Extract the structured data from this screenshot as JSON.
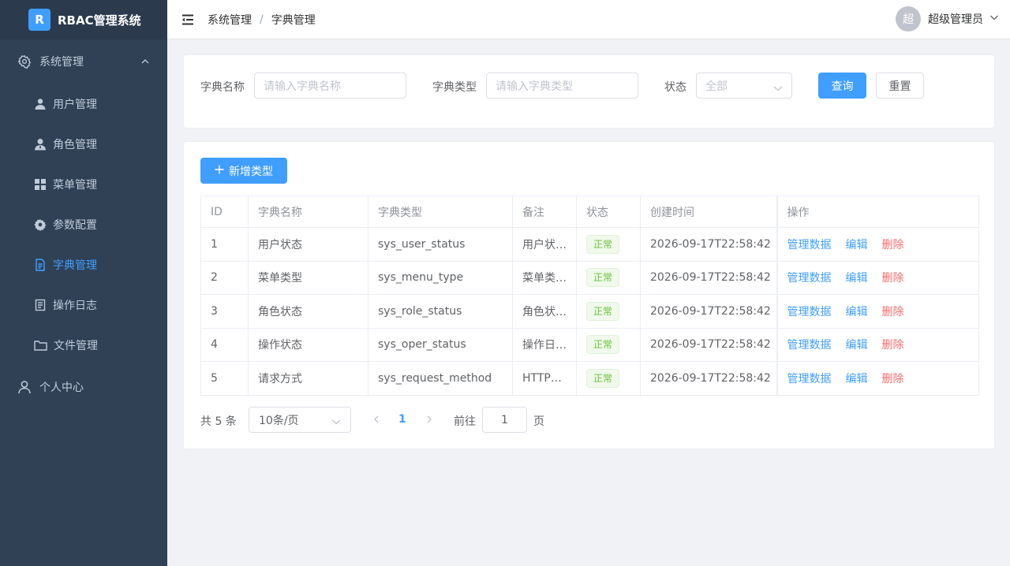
{
  "app": {
    "logo_letter": "R",
    "title": "RBAC管理系统"
  },
  "sidebar": {
    "group": {
      "label": "系统管理",
      "icon": "gear-icon",
      "expanded": true
    },
    "items": [
      {
        "label": "用户管理",
        "icon": "user-icon"
      },
      {
        "label": "角色管理",
        "icon": "role-icon"
      },
      {
        "label": "菜单管理",
        "icon": "grid-icon"
      },
      {
        "label": "参数配置",
        "icon": "settings-icon"
      },
      {
        "label": "字典管理",
        "icon": "document-icon",
        "active": true
      },
      {
        "label": "操作日志",
        "icon": "log-icon"
      },
      {
        "label": "文件管理",
        "icon": "folder-icon"
      }
    ],
    "personal": {
      "label": "个人中心",
      "icon": "person-outline-icon"
    }
  },
  "header": {
    "breadcrumb": [
      "系统管理",
      "字典管理"
    ],
    "separator": "/",
    "avatar_text": "超",
    "username": "超级管理员"
  },
  "search": {
    "name_label": "字典名称",
    "name_placeholder": "请输入字典名称",
    "type_label": "字典类型",
    "type_placeholder": "请输入字典类型",
    "status_label": "状态",
    "status_value": "全部",
    "query_button": "查询",
    "reset_button": "重置"
  },
  "toolbar": {
    "add_button": "新增类型"
  },
  "table": {
    "headers": [
      "ID",
      "字典名称",
      "字典类型",
      "备注",
      "状态",
      "创建时间",
      "操作"
    ],
    "rows": [
      {
        "id": "1",
        "name": "用户状态",
        "type": "sys_user_status",
        "remark": "用户状…",
        "status": "正常",
        "created": "2026-09-17T22:58:42"
      },
      {
        "id": "2",
        "name": "菜单类型",
        "type": "sys_menu_type",
        "remark": "菜单类…",
        "status": "正常",
        "created": "2026-09-17T22:58:42"
      },
      {
        "id": "3",
        "name": "角色状态",
        "type": "sys_role_status",
        "remark": "角色状…",
        "status": "正常",
        "created": "2026-09-17T22:58:42"
      },
      {
        "id": "4",
        "name": "操作状态",
        "type": "sys_oper_status",
        "remark": "操作日…",
        "status": "正常",
        "created": "2026-09-17T22:58:42"
      },
      {
        "id": "5",
        "name": "请求方式",
        "type": "sys_request_method",
        "remark": "HTTP…",
        "status": "正常",
        "created": "2026-09-17T22:58:42"
      }
    ],
    "actions": {
      "manage": "管理数据",
      "edit": "编辑",
      "delete": "删除"
    }
  },
  "pagination": {
    "total": "共 5 条",
    "page_size": "10条/页",
    "current_page": "1",
    "goto_label": "前往",
    "goto_value": "1",
    "goto_unit": "页"
  },
  "colors": {
    "primary": "#409eff",
    "sidebar_bg": "#304156",
    "danger": "#f56c6c",
    "success": "#67c23a"
  }
}
